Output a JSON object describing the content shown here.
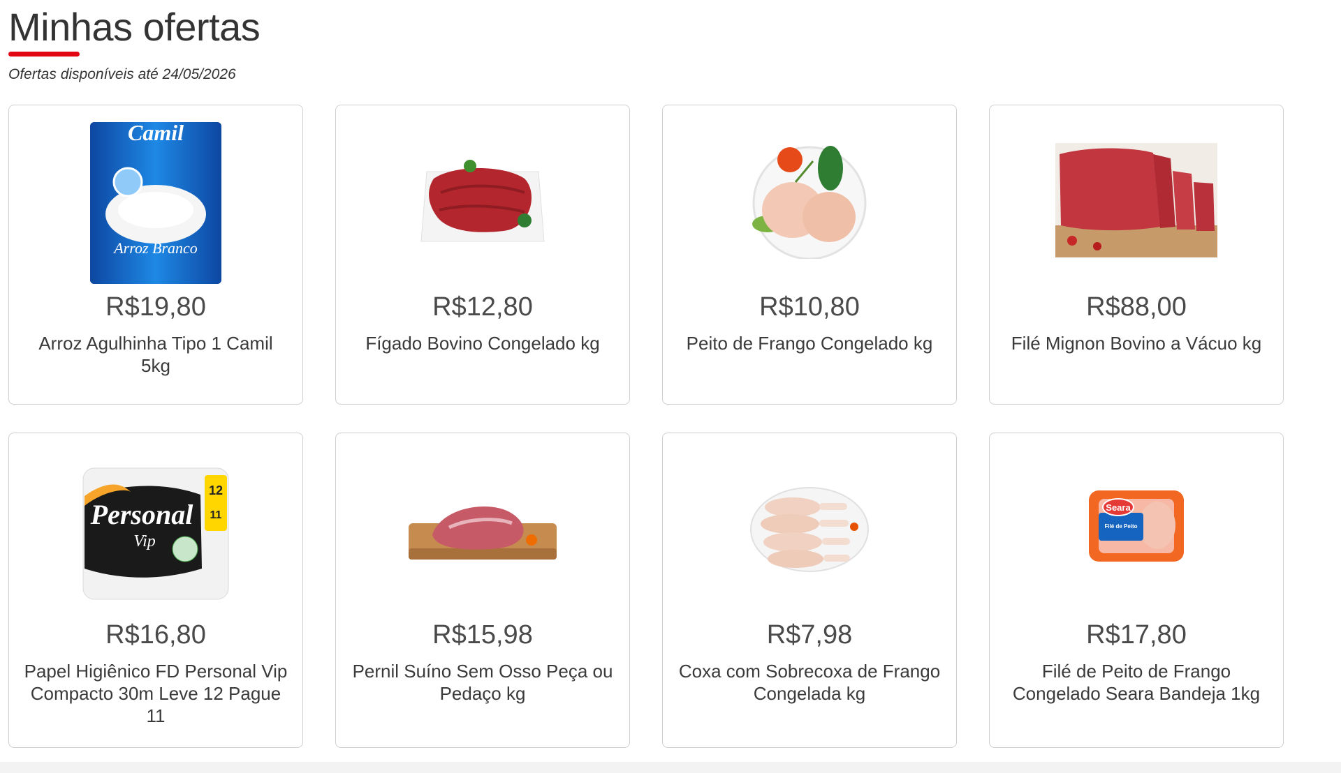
{
  "header": {
    "title": "Minhas ofertas",
    "subtitle": "Ofertas disponíveis até 24/05/2026",
    "accent_color": "#e30613"
  },
  "offers": [
    {
      "price": "R$19,80",
      "name": "Arroz Agulhinha Tipo 1 Camil 5kg",
      "image": "camil-rice-bag",
      "image_text": "Camil",
      "image_subtext": "Arroz Branco"
    },
    {
      "price": "R$12,80",
      "name": "Fígado Bovino Congelado kg",
      "image": "beef-liver-plate"
    },
    {
      "price": "R$10,80",
      "name": "Peito de Frango Congelado kg",
      "image": "chicken-breast-plate"
    },
    {
      "price": "R$88,00",
      "name": "Filé Mignon Bovino a Vácuo kg",
      "image": "filet-mignon-board"
    },
    {
      "price": "R$16,80",
      "name": "Papel Higiênico FD Personal Vip Compacto 30m Leve 12 Pague 11",
      "image": "toilet-paper-pack",
      "image_text": "Personal",
      "image_subtext": "Vip"
    },
    {
      "price": "R$15,98",
      "name": "Pernil Suíno Sem Osso Peça ou Pedaço kg",
      "image": "pork-leg-board"
    },
    {
      "price": "R$7,98",
      "name": "Coxa com Sobrecoxa de Frango Congelada kg",
      "image": "chicken-thighs-plate"
    },
    {
      "price": "R$17,80",
      "name": "Filé de Peito de Frango Congelado Seara Bandeja 1kg",
      "image": "seara-chicken-tray",
      "image_text": "Seara",
      "image_subtext": "Filé de Peito"
    }
  ]
}
